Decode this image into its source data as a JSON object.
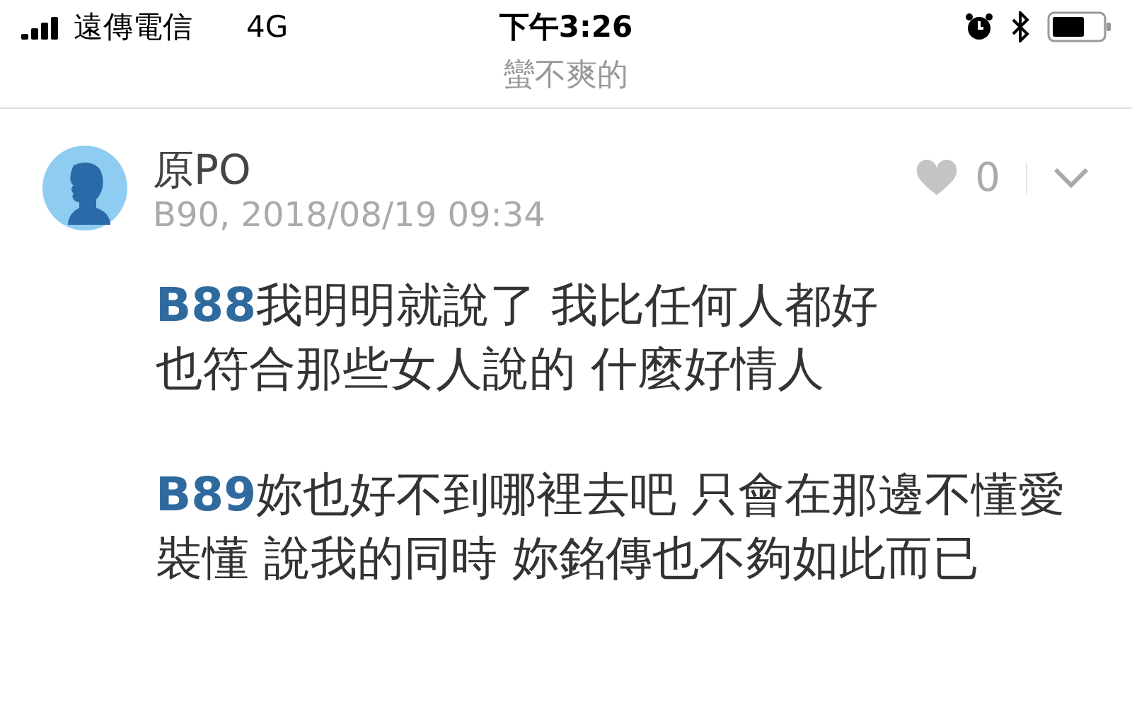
{
  "status_bar": {
    "carrier": "遠傳電信",
    "network": "4G",
    "time": "下午3:26"
  },
  "header": {
    "title": "蠻不爽的"
  },
  "post": {
    "author": "原PO",
    "meta": "B90, 2018/08/19 09:34",
    "likes": "0",
    "liked": false,
    "paragraphs": [
      {
        "ref": "B88",
        "lines": [
          "我明明就說了 我比任何人都好",
          "也符合那些女人說的 什麼好情人"
        ]
      },
      {
        "ref": "B89",
        "lines": [
          "妳也好不到哪裡去吧 只會在那邊不懂愛裝懂 說我的同時 妳銘傳也不夠如此而已"
        ]
      }
    ]
  }
}
